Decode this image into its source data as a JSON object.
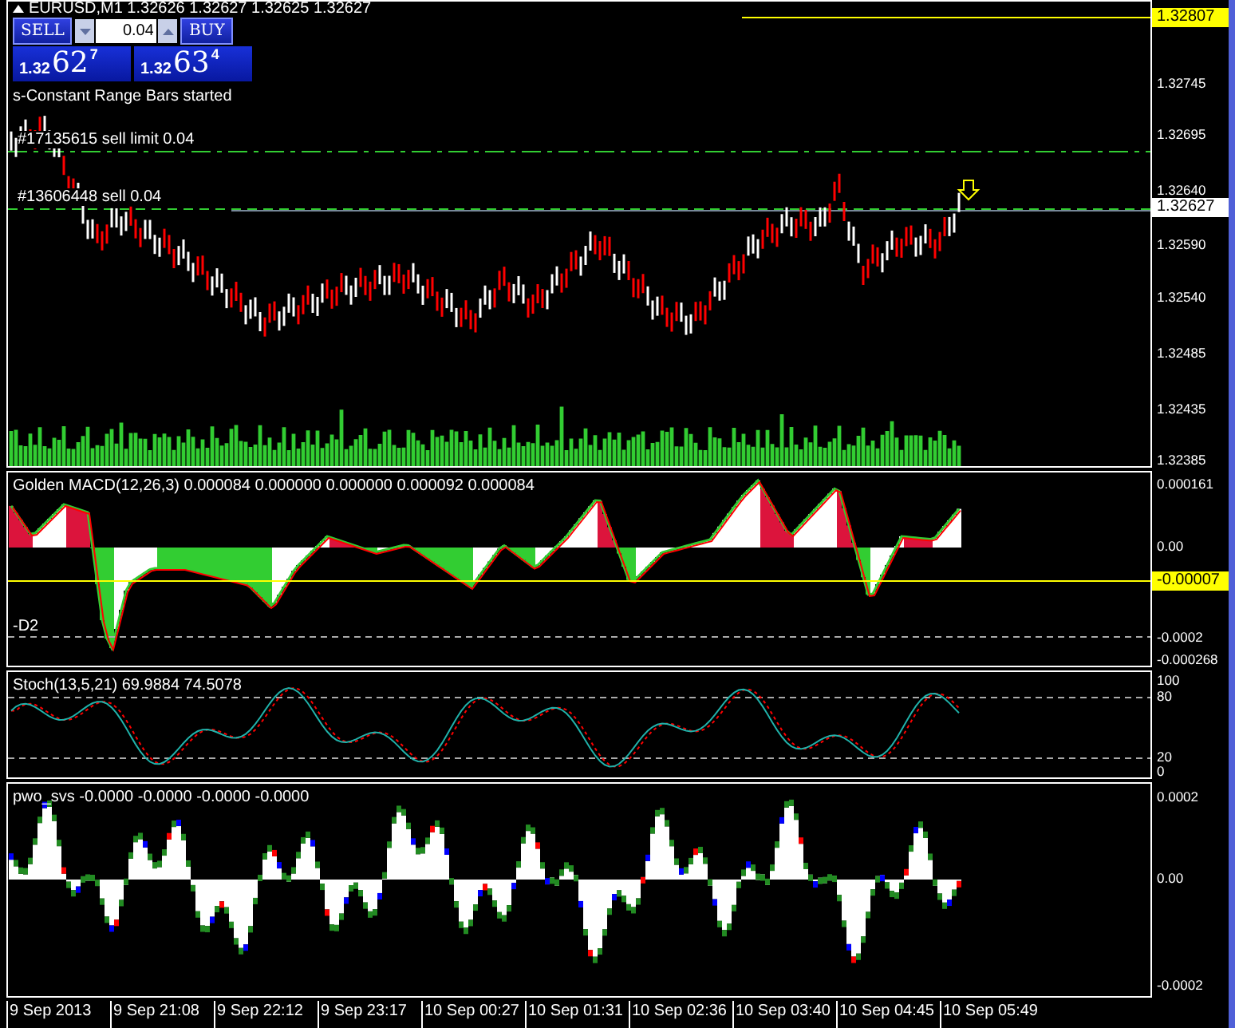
{
  "symbol_bar": {
    "text": "EURUSD,M1  1.32626 1.32627 1.32625 1.32627"
  },
  "trade_panel": {
    "sell_label": "SELL",
    "buy_label": "BUY",
    "lot": "0.04",
    "sell_price": {
      "prefix": "1.32",
      "big": "62",
      "sup": "7"
    },
    "buy_price": {
      "prefix": "1.32",
      "big": "63",
      "sup": "4"
    }
  },
  "status_message": "s-Constant Range Bars started",
  "orders": [
    {
      "label": "#17135615 sell limit 0.04",
      "kind": "pending"
    },
    {
      "label": "#13606448 sell 0.04",
      "kind": "market"
    }
  ],
  "price_axis": {
    "ticks": [
      "1.32745",
      "1.32695",
      "1.32640",
      "1.32590",
      "1.32540",
      "1.32485",
      "1.32435",
      "1.32385"
    ],
    "markers": [
      {
        "label": "1.32807",
        "kind": "high"
      },
      {
        "label": "1.32627",
        "kind": "bid"
      }
    ]
  },
  "macd": {
    "title": "Golden MACD(12,26,3) 0.000084 0.000000 0.000000 0.000092 0.000084",
    "level_label": "-D2",
    "ticks": [
      "0.000161",
      "0.00",
      "-0.0002",
      "-0.000268"
    ],
    "markers": [
      {
        "label": "-0.00007",
        "kind": "signal"
      }
    ]
  },
  "stochastic": {
    "title": "Stoch(13,5,21) 69.9884 74.5078",
    "ticks": [
      "100",
      "80",
      "20",
      "0"
    ]
  },
  "pwo": {
    "title": "pwo_svs -0.0000 -0.0000 -0.0000 -0.0000",
    "ticks": [
      "0.0002",
      "0.00",
      "-0.0002"
    ]
  },
  "time_axis": [
    "9 Sep 2013",
    "9 Sep 21:08",
    "9 Sep 22:12",
    "9 Sep 23:17",
    "10 Sep 00:27",
    "10 Sep 01:31",
    "10 Sep 02:36",
    "10 Sep 03:40",
    "10 Sep 04:45",
    "10 Sep 05:49"
  ]
}
